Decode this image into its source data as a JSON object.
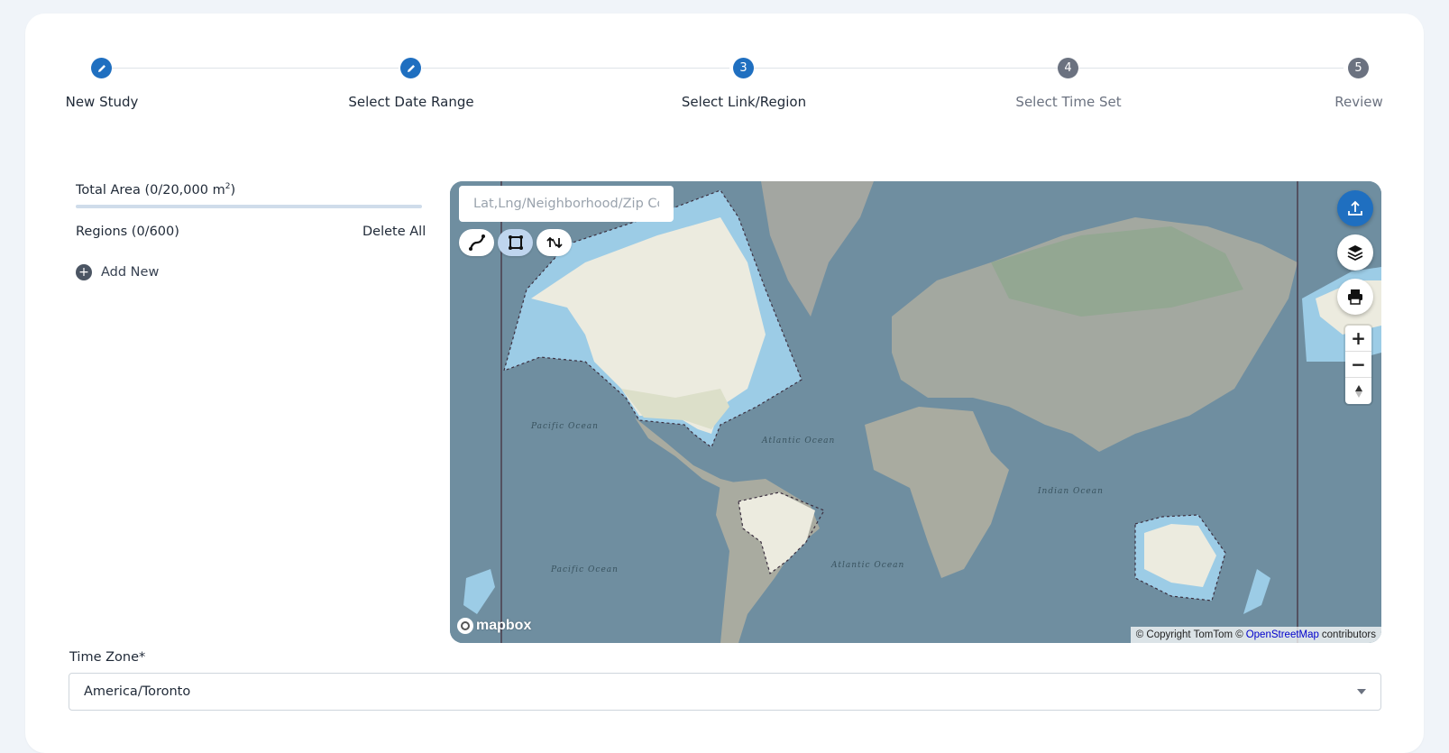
{
  "stepper": {
    "steps": [
      {
        "label": "New Study",
        "marker": "",
        "state": "done"
      },
      {
        "label": "Select Date Range",
        "marker": "",
        "state": "done"
      },
      {
        "label": "Select Link/Region",
        "marker": "3",
        "state": "active"
      },
      {
        "label": "Select Time Set",
        "marker": "4",
        "state": "todo"
      },
      {
        "label": "Review",
        "marker": "5",
        "state": "todo"
      }
    ]
  },
  "panel": {
    "total_area_prefix": "Total Area (0/20,000 m",
    "total_area_sup": "2",
    "total_area_suffix": ")",
    "area_used_fraction": 0,
    "regions_label": "Regions (0/600)",
    "delete_all_label": "Delete All",
    "add_new_label": "Add New"
  },
  "map": {
    "search_placeholder": "Lat,Lng/Neighborhood/Zip Cod",
    "ocean_labels": {
      "pacific": "Pacific Ocean",
      "atlantic": "Atlantic Ocean",
      "indian": "Indian Ocean"
    },
    "logo_text": "mapbox",
    "attribution": {
      "prefix": "© Copyright TomTom ©",
      "link": "OpenStreetMap",
      "suffix": "contributors"
    },
    "colors": {
      "water": "#6f8ea0",
      "land": "#a9aba0",
      "selected_land": "#ecebdf",
      "shallow": "#9ccce6",
      "accent": "#1f6fc0"
    }
  },
  "timezone": {
    "label": "Time Zone*",
    "value": "America/Toronto"
  }
}
